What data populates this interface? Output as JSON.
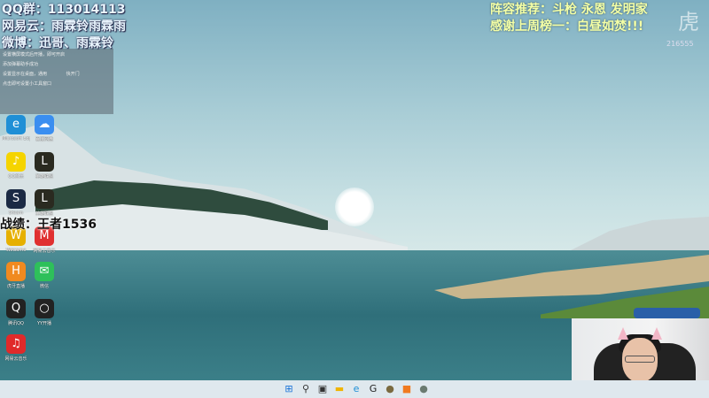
{
  "stream_overlay": {
    "left_lines": [
      "QQ群：113014113",
      "网易云：雨霖铃雨霖雨",
      "微博：迅哥、雨霖铃"
    ],
    "right_lines": [
      "阵容推荐：斗枪 永恩 发明家",
      "感谢上周榜一：白昼如焚!!!"
    ],
    "record": "战绩：王者1536",
    "room_logo": "虎牙",
    "room_id": "216555"
  },
  "notice_panel": {
    "lines": [
      "设置横屏模式后开播，即可开启",
      "添加弹幕助手成功",
      "设置显示在桌面，通用",
      "点击即可设置小工具窗口"
    ],
    "button": "快开门"
  },
  "desktop_icons": [
    {
      "label": "Microsoft Edge",
      "glyph": "e",
      "color": "#1f8fd6"
    },
    {
      "label": "百度网盘",
      "glyph": "☁",
      "color": "#3a8ef0"
    },
    {
      "label": "QQ音乐",
      "glyph": "♪",
      "color": "#f5d400"
    },
    {
      "label": "英雄联盟",
      "glyph": "L",
      "color": "#2a2a20"
    },
    {
      "label": "Steam",
      "glyph": "S",
      "color": "#1b2a44"
    },
    {
      "label": "英雄联盟",
      "glyph": "L",
      "color": "#2a2a20"
    },
    {
      "label": "WeGame",
      "glyph": "W",
      "color": "#e6b000"
    },
    {
      "label": "网易云音乐",
      "glyph": "M",
      "color": "#e03030"
    },
    {
      "label": "虎牙直播",
      "glyph": "H",
      "color": "#f08a20"
    },
    {
      "label": "微信",
      "glyph": "✉",
      "color": "#2ec05a"
    },
    {
      "label": "腾讯QQ",
      "glyph": "Q",
      "color": "#222"
    },
    {
      "label": "YY开播",
      "glyph": "○",
      "color": "#222"
    },
    {
      "label": "网易云音乐",
      "glyph": "♫",
      "color": "#e02a2a"
    }
  ],
  "taskbar": [
    {
      "name": "start",
      "glyph": "⊞",
      "color": "#1a73d8"
    },
    {
      "name": "search",
      "glyph": "⚲",
      "color": "#333"
    },
    {
      "name": "task-view",
      "glyph": "▣",
      "color": "#333"
    },
    {
      "name": "file-explorer",
      "glyph": "▬",
      "color": "#f0b400"
    },
    {
      "name": "edge",
      "glyph": "e",
      "color": "#1f8fd6"
    },
    {
      "name": "app-g",
      "glyph": "G",
      "color": "#222"
    },
    {
      "name": "league",
      "glyph": "●",
      "color": "#7a6a40"
    },
    {
      "name": "huya",
      "glyph": "■",
      "color": "#f07a20"
    },
    {
      "name": "league-2",
      "glyph": "●",
      "color": "#6a7a70"
    }
  ]
}
